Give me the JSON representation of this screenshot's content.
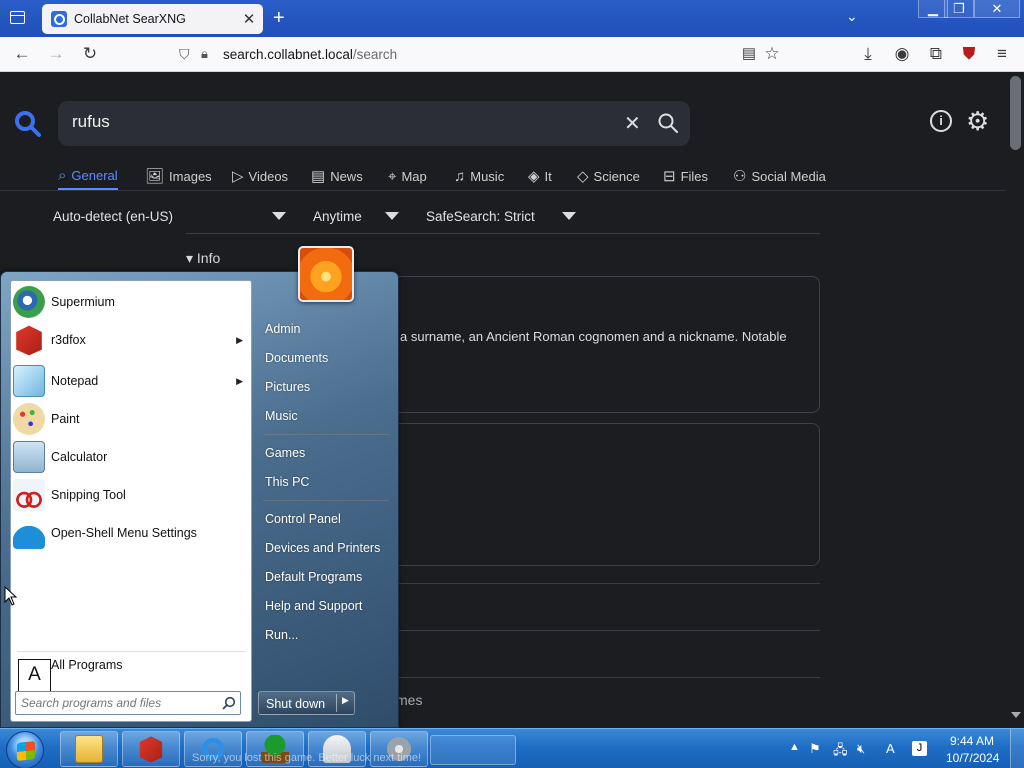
{
  "browser": {
    "tab_title": "CollabNet SearXNG",
    "tab_close": "✕",
    "new_tab": "+",
    "url_host": "search.collabnet.local",
    "url_path": "/search"
  },
  "search": {
    "query": "rufus",
    "clear_glyph": "✕"
  },
  "categories": [
    {
      "label": "General",
      "icon": "search-icon"
    },
    {
      "label": "Images",
      "icon": "image-icon"
    },
    {
      "label": "Videos",
      "icon": "play-icon"
    },
    {
      "label": "News",
      "icon": "newspaper-icon"
    },
    {
      "label": "Map",
      "icon": "map-pin-icon"
    },
    {
      "label": "Music",
      "icon": "music-note-icon"
    },
    {
      "label": "It",
      "icon": "layers-icon"
    },
    {
      "label": "Science",
      "icon": "graduation-cap-icon"
    },
    {
      "label": "Files",
      "icon": "files-icon"
    },
    {
      "label": "Social Media",
      "icon": "people-icon"
    }
  ],
  "filters": {
    "language": "Auto-detect (en-US)",
    "time": "Anytime",
    "safesearch": "SafeSearch: Strict"
  },
  "infobox": {
    "header": "▾ Info",
    "line1": "a surname, an Ancient Roman cognomen and a nickname. Notable"
  },
  "result_tail": "mes",
  "start_menu": {
    "programs": [
      {
        "label": "Supermium",
        "has_submenu": false
      },
      {
        "label": "r3dfox",
        "has_submenu": true
      },
      {
        "label": "Notepad",
        "has_submenu": true
      },
      {
        "label": "Paint",
        "has_submenu": false
      },
      {
        "label": "Calculator",
        "has_submenu": false
      },
      {
        "label": "Snipping Tool",
        "has_submenu": false
      },
      {
        "label": "Open-Shell Menu Settings",
        "has_submenu": false
      }
    ],
    "all_programs": "All Programs",
    "search_placeholder": "Search programs and files",
    "places": [
      "Admin",
      "Documents",
      "Pictures",
      "Music",
      "Games",
      "This PC",
      "Control Panel",
      "Devices and Printers",
      "Default Programs",
      "Help and Support",
      "Run..."
    ],
    "shutdown": "Shut down",
    "key_overlay": "A"
  },
  "taskbar": {
    "ghost_text": "Sorry, you lost this game. Better luck next time!",
    "time": "9:44 AM",
    "date": "10/7/2024",
    "ime": "A"
  },
  "colors": {
    "accent": "#5b8cff",
    "taskbar": "#1f6ec6"
  }
}
